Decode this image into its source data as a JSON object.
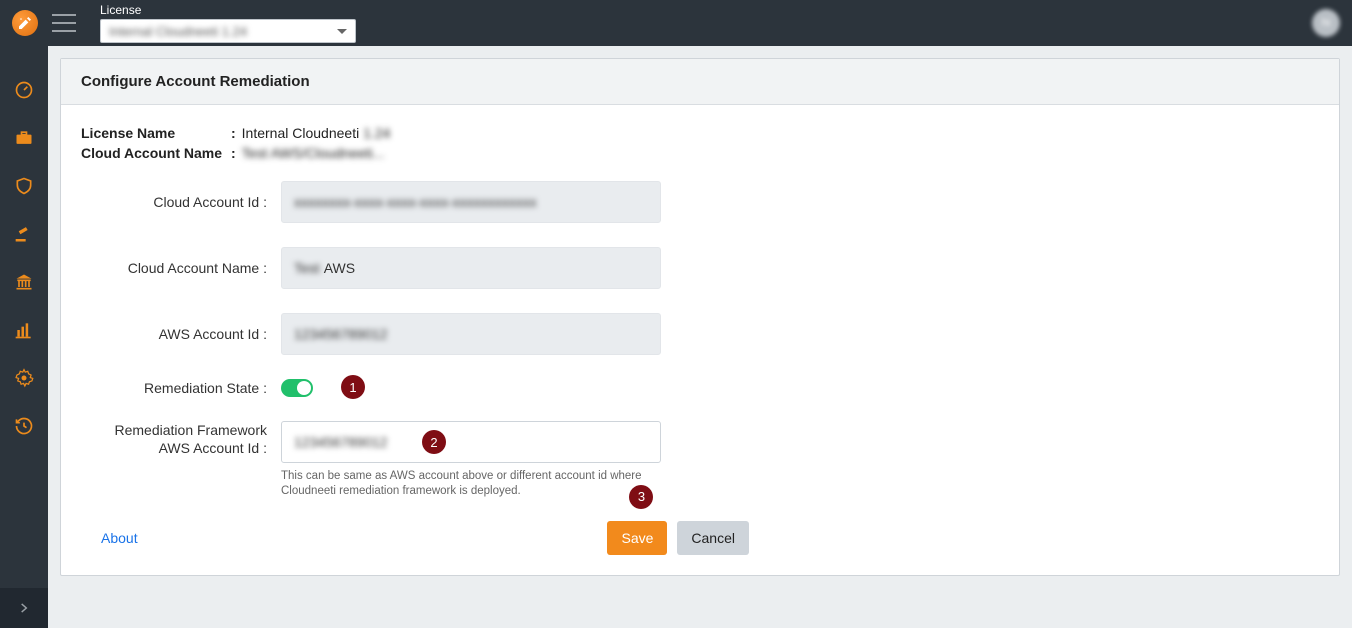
{
  "header": {
    "license_label": "License",
    "license_dropdown_value": "Internal Cloudneeti 1.24"
  },
  "page": {
    "title": "Configure Account Remediation",
    "meta": {
      "license_name_label": "License Name",
      "license_name_value_visible": "Internal Cloudneeti",
      "license_name_value_blurred": "1.24",
      "cloud_account_name_label": "Cloud Account Name",
      "cloud_account_name_value": "Test AWS/Cloudneeti..."
    },
    "fields": {
      "cloud_account_id_label": "Cloud Account Id :",
      "cloud_account_id_value": "xxxxxxxx-xxxx-xxxx-xxxx-xxxxxxxxxxxx",
      "cloud_account_name_label": "Cloud Account Name :",
      "cloud_account_name_value_visible": "AWS",
      "cloud_account_name_value_blurred": "Test",
      "aws_account_id_label": "AWS Account Id :",
      "aws_account_id_value": "123456789012",
      "remediation_state_label": "Remediation State :",
      "framework_account_id_label": "Remediation Framework AWS Account Id :",
      "framework_account_id_value": "123456789012",
      "framework_help_text": "This can be same as AWS account above or different account id where Cloudneeti remediation framework is deployed."
    },
    "footer": {
      "about": "About",
      "save": "Save",
      "cancel": "Cancel"
    },
    "annotations": {
      "a1": "1",
      "a2": "2",
      "a3": "3"
    }
  }
}
